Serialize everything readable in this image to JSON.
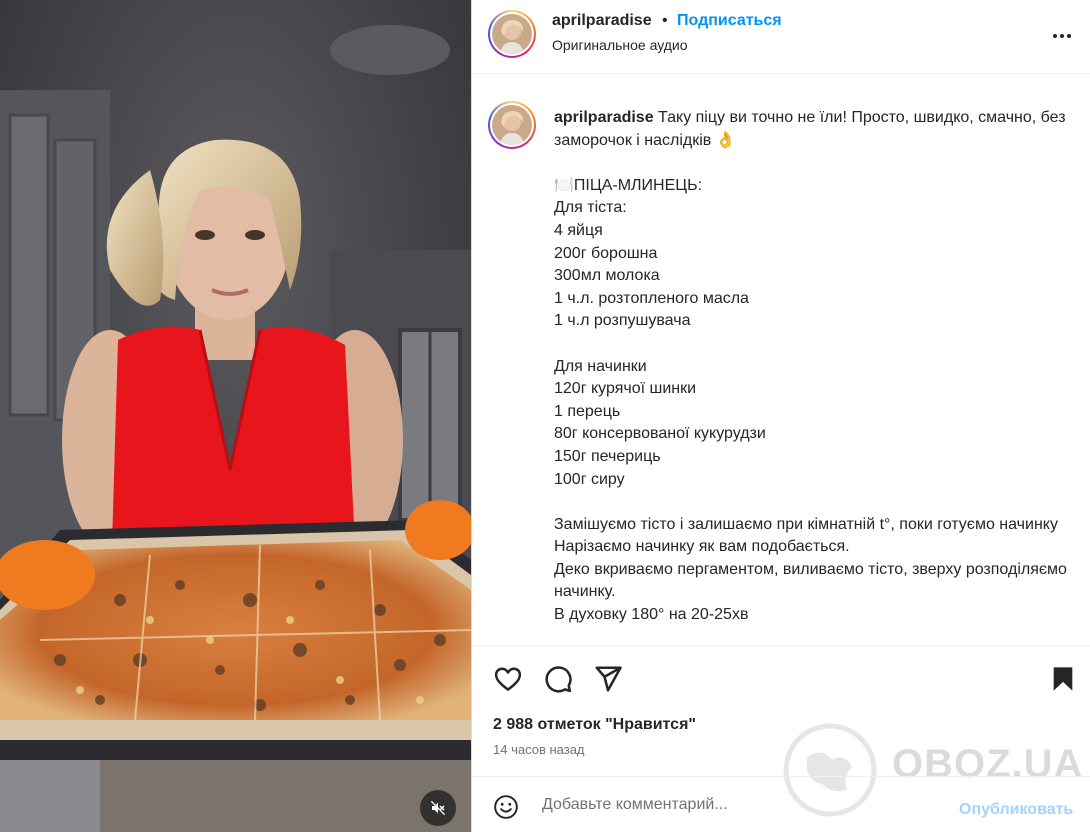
{
  "header": {
    "username": "aprilparadise",
    "separator": "•",
    "follow_label": "Подписаться",
    "audio_label": "Оригинальное аудио"
  },
  "caption": {
    "username": "aprilparadise",
    "text": " Таку піцу ви точно не їли! Просто, швидко, смачно, без заморочок і наслідків 👌\n\n🍽️ПІЦА-МЛИНЕЦЬ:\nДля тіста:\n4 яйця\n200г борошна\n300мл молока\n1 ч.л. розтопленого масла\n1 ч.л розпушувача\n\nДля начинки\n120г курячої шинки\n1 перець\n80г консервованої кукурудзи\n150г печериць\n100г сиру\n\nЗамішуємо тісто і залишаємо при кімнатній t°, поки готуємо начинку\nНарізаємо начинку як вам подобається.\nДеко вкриваємо пергаментом, виливаємо тісто, зверху розподіляємо начинку.\nВ духовку 180° на 20-25хв"
  },
  "stats": {
    "likes": "2 988 отметок \"Нравится\"",
    "time_ago": "14 часов назад"
  },
  "comment": {
    "placeholder": "Добавьте комментарий...",
    "publish_label": "Опубликовать"
  },
  "watermark": {
    "text": "OBOZ.UA"
  },
  "icons": {
    "more": "more-horizontal-icon",
    "like": "heart-icon",
    "comment": "comment-icon",
    "share": "share-icon",
    "save": "bookmark-icon",
    "emoji": "emoji-icon",
    "mute": "speaker-muted-icon"
  },
  "colors": {
    "follow": "#0095f6",
    "publish_disabled": "#a3d3fb",
    "muted_text": "#737373",
    "text": "#262626"
  }
}
